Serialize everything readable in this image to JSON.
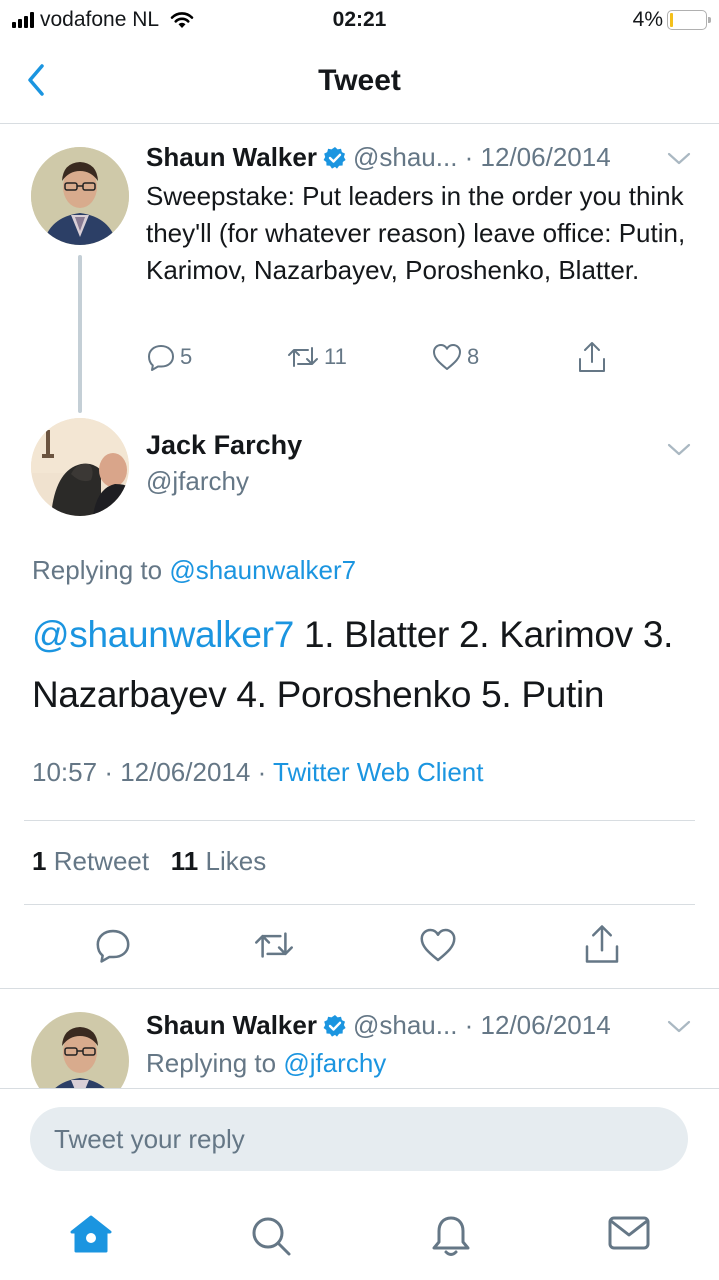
{
  "status_bar": {
    "carrier": "vodafone NL",
    "time": "02:21",
    "battery": "4%"
  },
  "nav": {
    "title": "Tweet"
  },
  "parent_tweet": {
    "name": "Shaun Walker",
    "handle": "@shau...",
    "date": "12/06/2014",
    "text": "Sweepstake: Put leaders in the order you think they'll (for whatever reason) leave office: Putin, Karimov, Nazarbayev, Poroshenko, Blatter.",
    "replies": "5",
    "retweets": "11",
    "likes": "8"
  },
  "focus_tweet": {
    "name": "Jack Farchy",
    "handle": "@jfarchy",
    "replying_prefix": "Replying to",
    "replying_handle": "@shaunwalker7",
    "mention": "@shaunwalker7",
    "text": " 1. Blatter 2. Karimov 3. Nazarbayev 4. Poroshenko 5. Putin",
    "time": "10:57",
    "date": "12/06/2014",
    "client": "Twitter Web Client",
    "retweet_count": "1",
    "retweet_label": "Retweet",
    "like_count": "11",
    "like_label": "Likes"
  },
  "reply_tweet": {
    "name": "Shaun Walker",
    "handle": "@shau...",
    "date": "12/06/2014",
    "replying_prefix": "Replying to",
    "replying_handle": "@jfarchy"
  },
  "composer": {
    "placeholder": "Tweet your reply"
  },
  "tabbar": [
    "home-icon",
    "search-icon",
    "notifications-icon",
    "messages-icon"
  ],
  "colors": {
    "accent": "#1b95e0",
    "muted": "#657786",
    "battery": "#f4c01b"
  }
}
